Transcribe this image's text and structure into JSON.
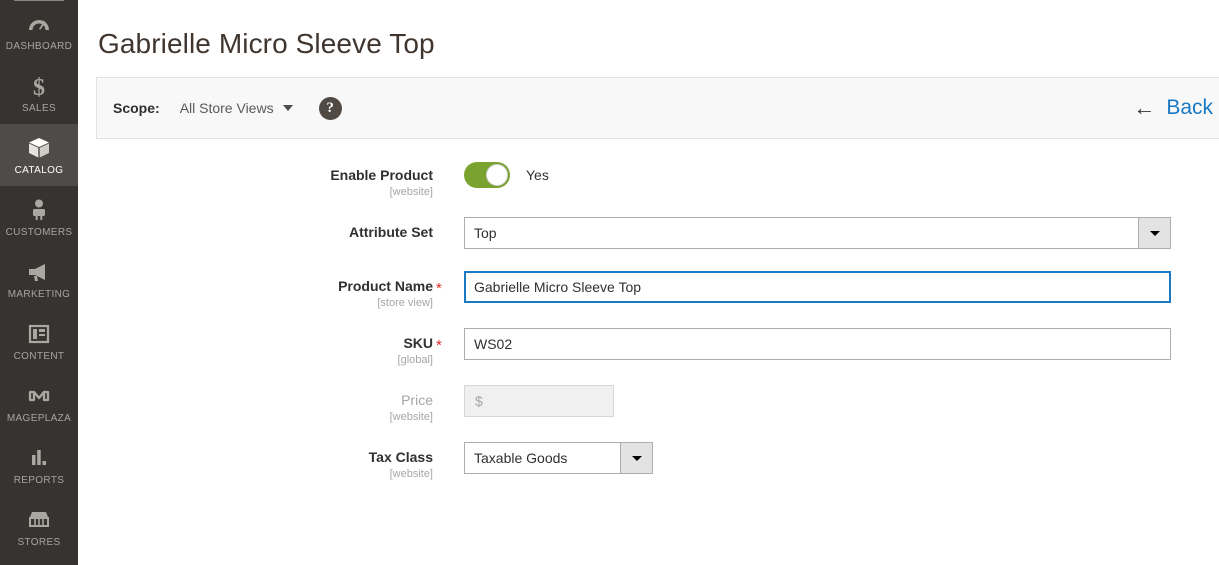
{
  "sidebar": {
    "items": [
      {
        "label": "DASHBOARD",
        "icon": "dashboard-icon",
        "active": false
      },
      {
        "label": "SALES",
        "icon": "dollar-icon",
        "active": false
      },
      {
        "label": "CATALOG",
        "icon": "box-icon",
        "active": true
      },
      {
        "label": "CUSTOMERS",
        "icon": "person-icon",
        "active": false
      },
      {
        "label": "MARKETING",
        "icon": "megaphone-icon",
        "active": false
      },
      {
        "label": "CONTENT",
        "icon": "layout-icon",
        "active": false
      },
      {
        "label": "MAGEPLAZA",
        "icon": "mageplaza-icon",
        "active": false
      },
      {
        "label": "REPORTS",
        "icon": "bar-chart-icon",
        "active": false
      },
      {
        "label": "STORES",
        "icon": "store-icon",
        "active": false
      }
    ]
  },
  "header": {
    "page_title": "Gabrielle Micro Sleeve Top"
  },
  "scope_bar": {
    "scope_label": "Scope:",
    "scope_value": "All Store Views",
    "help_glyph": "?",
    "back_arrow": "←",
    "back_label": "Back"
  },
  "form": {
    "enable_product": {
      "label": "Enable Product",
      "scope": "[website]",
      "state_text": "Yes",
      "on": true
    },
    "attribute_set": {
      "label": "Attribute Set",
      "value": "Top"
    },
    "product_name": {
      "label": "Product Name",
      "scope": "[store view]",
      "required_mark": "*",
      "value": "Gabrielle Micro Sleeve Top",
      "focused": true
    },
    "sku": {
      "label": "SKU",
      "scope": "[global]",
      "required_mark": "*",
      "value": "WS02"
    },
    "price": {
      "label": "Price",
      "scope": "[website]",
      "currency_symbol": "$",
      "value": "",
      "disabled": true
    },
    "tax_class": {
      "label": "Tax Class",
      "scope": "[website]",
      "value": "Taxable Goods"
    }
  },
  "colors": {
    "sidebar_bg": "#373330",
    "sidebar_active_bg": "#4f4b48",
    "toggle_on": "#79a22e",
    "link_blue": "#1979c3",
    "required_red": "#e02b27",
    "help_circle": "#514943"
  }
}
